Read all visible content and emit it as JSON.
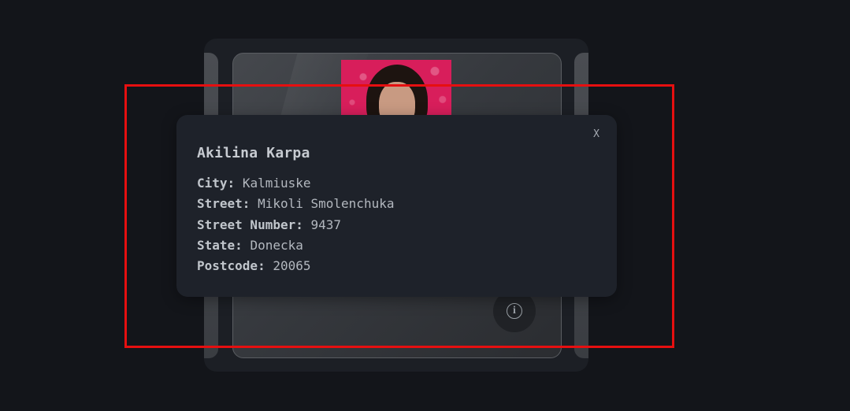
{
  "modal": {
    "name": "Akilina Karpa",
    "close_label": "X",
    "details": [
      {
        "label": "City:",
        "value": "Kalmiuske"
      },
      {
        "label": "Street:",
        "value": "Mikoli Smolenchuka"
      },
      {
        "label": "Street Number:",
        "value": "9437"
      },
      {
        "label": "State:",
        "value": "Donecka"
      },
      {
        "label": "Postcode:",
        "value": "20065"
      }
    ]
  },
  "card": {
    "info_icon": "info-icon",
    "info_glyph": "i"
  },
  "colors": {
    "background": "#13151a",
    "modal_background": "#1e222a",
    "highlight": "#e60f10",
    "photo_background": "#d81e5b"
  }
}
